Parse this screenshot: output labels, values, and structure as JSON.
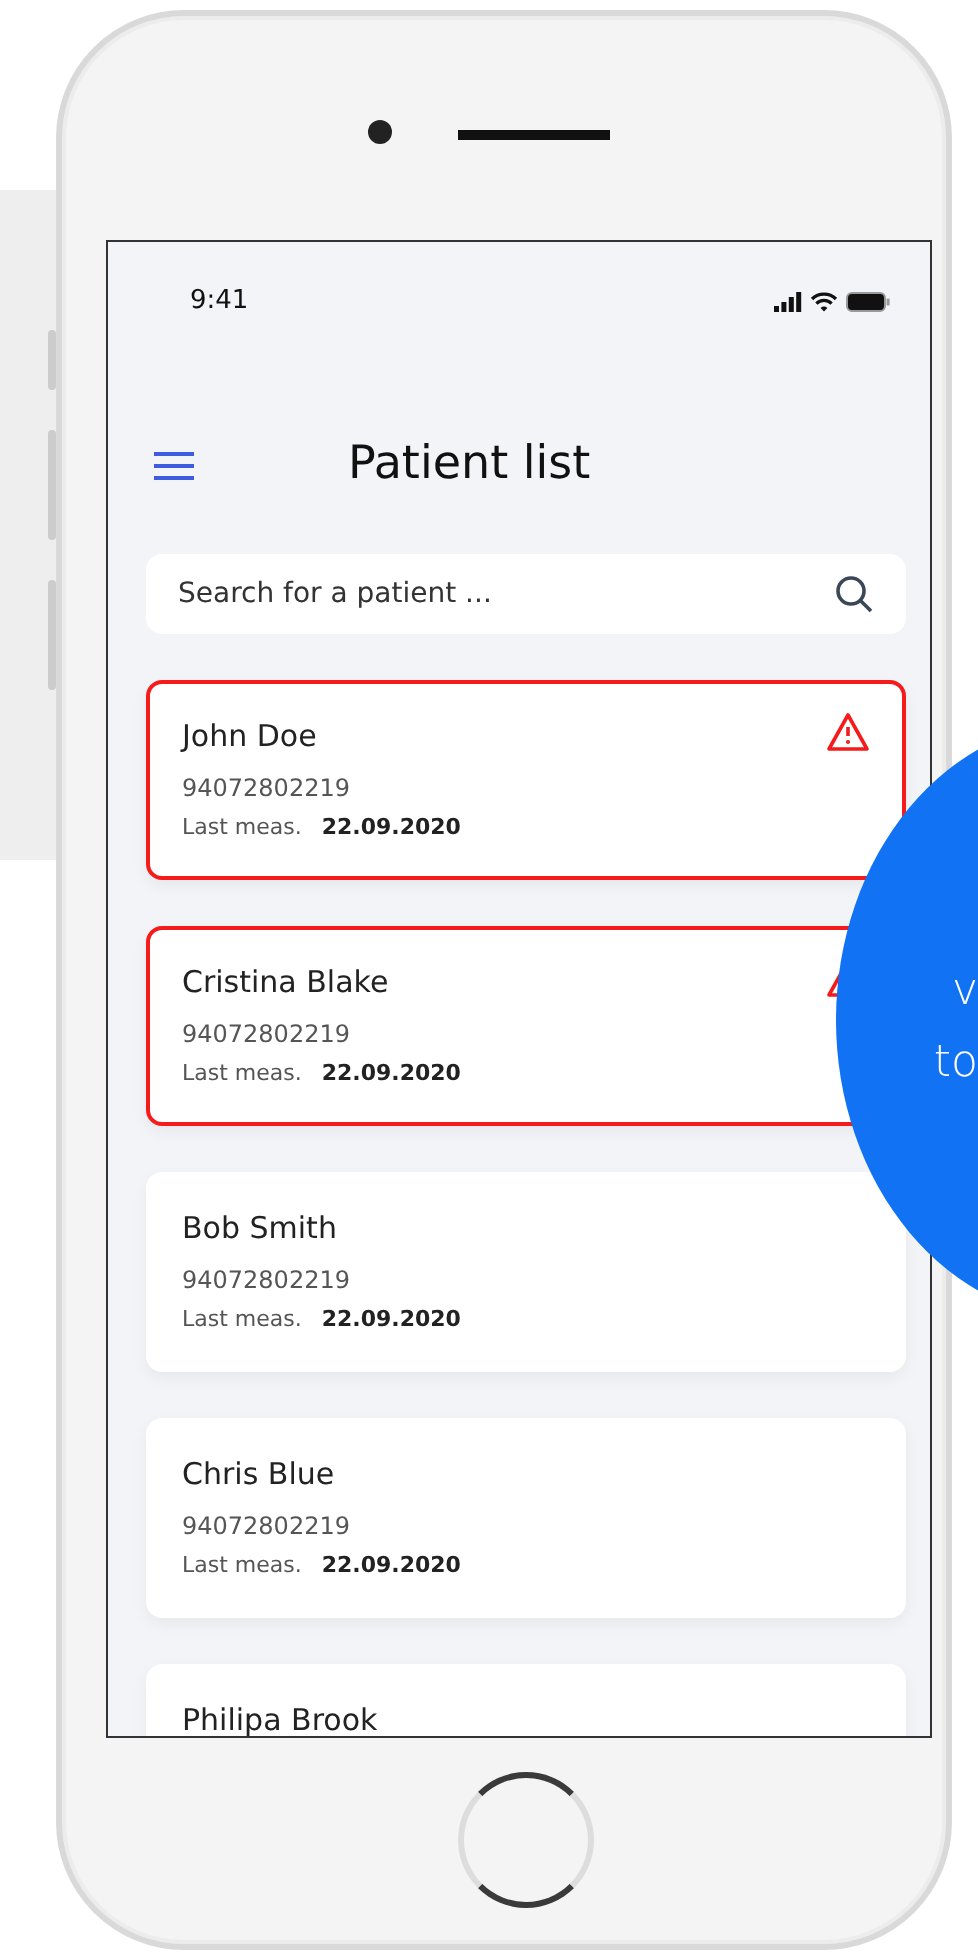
{
  "status_bar": {
    "time": "9:41"
  },
  "header": {
    "title": "Patient list"
  },
  "search": {
    "placeholder": "Search for a patient ..."
  },
  "patients": [
    {
      "name": "John Doe",
      "id": "94072802219",
      "meas_label": "Last meas.",
      "meas_date": "22.09.2020",
      "alert": true
    },
    {
      "name": "Cristina Blake",
      "id": "94072802219",
      "meas_label": "Last meas.",
      "meas_date": "22.09.2020",
      "alert": true
    },
    {
      "name": "Bob Smith",
      "id": "94072802219",
      "meas_label": "Last meas.",
      "meas_date": "22.09.2020",
      "alert": false
    },
    {
      "name": "Chris Blue",
      "id": "94072802219",
      "meas_label": "Last meas.",
      "meas_date": "22.09.2020",
      "alert": false
    },
    {
      "name": "Philipa Brook",
      "alert": false
    }
  ],
  "bubble": {
    "lines": [
      "v",
      "to"
    ]
  }
}
